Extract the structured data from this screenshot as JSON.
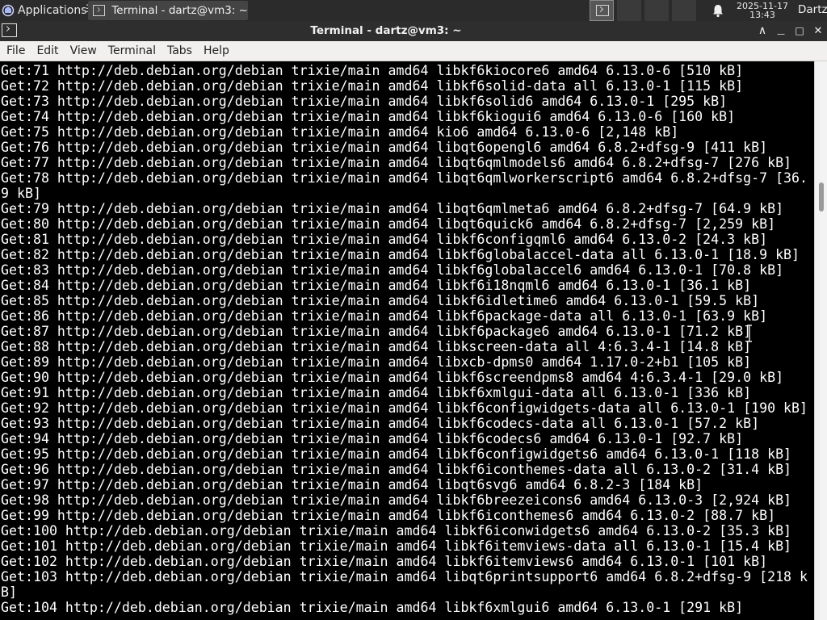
{
  "panel": {
    "applications_label": "Applications",
    "separator": "☰",
    "task_label": "Terminal - dartz@vm3: ~",
    "clock_date": "2025-11-17",
    "clock_time": "13:43",
    "user": "Dartz"
  },
  "window": {
    "title": "Terminal - dartz@vm3: ~",
    "minimize_icon": "—",
    "maximize_icon": "□",
    "close_icon": "✕",
    "shade_icon": "∧"
  },
  "menu": [
    "File",
    "Edit",
    "View",
    "Terminal",
    "Tabs",
    "Help"
  ],
  "terminal": {
    "lines": [
      "Get:71 http://deb.debian.org/debian trixie/main amd64 libkf6kiocore6 amd64 6.13.0-6 [510 kB]",
      "Get:72 http://deb.debian.org/debian trixie/main amd64 libkf6solid-data all 6.13.0-1 [115 kB]",
      "Get:73 http://deb.debian.org/debian trixie/main amd64 libkf6solid6 amd64 6.13.0-1 [295 kB]",
      "Get:74 http://deb.debian.org/debian trixie/main amd64 libkf6kiogui6 amd64 6.13.0-6 [160 kB]",
      "Get:75 http://deb.debian.org/debian trixie/main amd64 kio6 amd64 6.13.0-6 [2,148 kB]",
      "Get:76 http://deb.debian.org/debian trixie/main amd64 libqt6opengl6 amd64 6.8.2+dfsg-9 [411 kB]",
      "Get:77 http://deb.debian.org/debian trixie/main amd64 libqt6qmlmodels6 amd64 6.8.2+dfsg-7 [276 kB]",
      "Get:78 http://deb.debian.org/debian trixie/main amd64 libqt6qmlworkerscript6 amd64 6.8.2+dfsg-7 [36.",
      "9 kB]",
      "Get:79 http://deb.debian.org/debian trixie/main amd64 libqt6qmlmeta6 amd64 6.8.2+dfsg-7 [64.9 kB]",
      "Get:80 http://deb.debian.org/debian trixie/main amd64 libqt6quick6 amd64 6.8.2+dfsg-7 [2,259 kB]",
      "Get:81 http://deb.debian.org/debian trixie/main amd64 libkf6configqml6 amd64 6.13.0-2 [24.3 kB]",
      "Get:82 http://deb.debian.org/debian trixie/main amd64 libkf6globalaccel-data all 6.13.0-1 [18.9 kB]",
      "Get:83 http://deb.debian.org/debian trixie/main amd64 libkf6globalaccel6 amd64 6.13.0-1 [70.8 kB]",
      "Get:84 http://deb.debian.org/debian trixie/main amd64 libkf6i18nqml6 amd64 6.13.0-1 [36.1 kB]",
      "Get:85 http://deb.debian.org/debian trixie/main amd64 libkf6idletime6 amd64 6.13.0-1 [59.5 kB]",
      "Get:86 http://deb.debian.org/debian trixie/main amd64 libkf6package-data all 6.13.0-1 [63.9 kB]",
      "Get:87 http://deb.debian.org/debian trixie/main amd64 libkf6package6 amd64 6.13.0-1 [71.2 kB]",
      "Get:88 http://deb.debian.org/debian trixie/main amd64 libkscreen-data all 4:6.3.4-1 [14.8 kB]",
      "Get:89 http://deb.debian.org/debian trixie/main amd64 libxcb-dpms0 amd64 1.17.0-2+b1 [105 kB]",
      "Get:90 http://deb.debian.org/debian trixie/main amd64 libkf6screendpms8 amd64 4:6.3.4-1 [29.0 kB]",
      "Get:91 http://deb.debian.org/debian trixie/main amd64 libkf6xmlgui-data all 6.13.0-1 [336 kB]",
      "Get:92 http://deb.debian.org/debian trixie/main amd64 libkf6configwidgets-data all 6.13.0-1 [190 kB]",
      "Get:93 http://deb.debian.org/debian trixie/main amd64 libkf6codecs-data all 6.13.0-1 [57.2 kB]",
      "Get:94 http://deb.debian.org/debian trixie/main amd64 libkf6codecs6 amd64 6.13.0-1 [92.7 kB]",
      "Get:95 http://deb.debian.org/debian trixie/main amd64 libkf6configwidgets6 amd64 6.13.0-1 [118 kB]",
      "Get:96 http://deb.debian.org/debian trixie/main amd64 libkf6iconthemes-data all 6.13.0-2 [31.4 kB]",
      "Get:97 http://deb.debian.org/debian trixie/main amd64 libqt6svg6 amd64 6.8.2-3 [184 kB]",
      "Get:98 http://deb.debian.org/debian trixie/main amd64 libkf6breezeicons6 amd64 6.13.0-3 [2,924 kB]",
      "Get:99 http://deb.debian.org/debian trixie/main amd64 libkf6iconthemes6 amd64 6.13.0-2 [88.7 kB]",
      "Get:100 http://deb.debian.org/debian trixie/main amd64 libkf6iconwidgets6 amd64 6.13.0-2 [35.3 kB]",
      "Get:101 http://deb.debian.org/debian trixie/main amd64 libkf6itemviews-data all 6.13.0-1 [15.4 kB]",
      "Get:102 http://deb.debian.org/debian trixie/main amd64 libkf6itemviews6 amd64 6.13.0-1 [101 kB]",
      "Get:103 http://deb.debian.org/debian trixie/main amd64 libqt6printsupport6 amd64 6.8.2+dfsg-9 [218 k",
      "B]",
      "Get:104 http://deb.debian.org/debian trixie/main amd64 libkf6xmlgui6 amd64 6.13.0-1 [291 kB]"
    ]
  }
}
